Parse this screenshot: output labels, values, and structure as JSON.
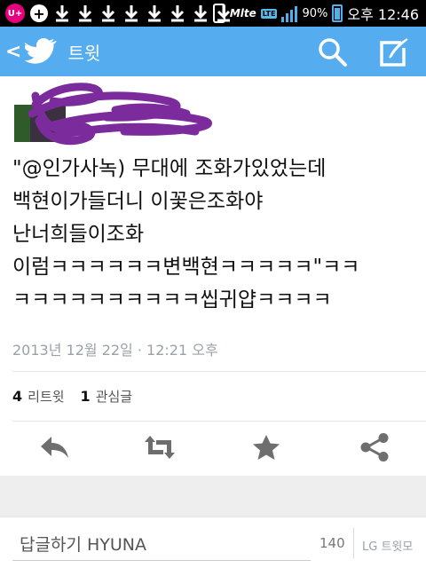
{
  "status_bar": {
    "carrier_icon": "U+",
    "plus_icon": "+",
    "network_label": "Mlte",
    "lte_badge": "LTE",
    "battery": "90%",
    "time": "오후 12:46"
  },
  "app_bar": {
    "back_icon": "<",
    "title": "트윗",
    "search_icon": "search-icon",
    "compose_icon": "compose-icon"
  },
  "tweet": {
    "handle": "@",
    "text": "\"@인가사녹) 무대에 조화가있었는데\n백현이가들더니 이꽃은조화야\n난너희들이조화\n이럼ㅋㅋㅋㅋㅋㅋ변백현ㅋㅋㅋㅋㅋ\"ㅋㅋ\nㅋㅋㅋㅋㅋㅋㅋㅋㅋㅋ씹귀얍ㅋㅋㅋㅋ",
    "timestamp": "2013년 12월 22일 · 12:21 오후",
    "retweet_count": "4",
    "retweet_label": "리트윗",
    "favorite_count": "1",
    "favorite_label": "관심글"
  },
  "actions": [
    "reply-icon",
    "retweet-icon",
    "favorite-icon",
    "share-icon"
  ],
  "reply_bar": {
    "placeholder": "답글하기 HYUNA",
    "char_count": "140",
    "brand": "LG 트윗모"
  },
  "colors": {
    "twitter_blue": "#55acee",
    "scribble_purple": "#7b2b9c"
  }
}
